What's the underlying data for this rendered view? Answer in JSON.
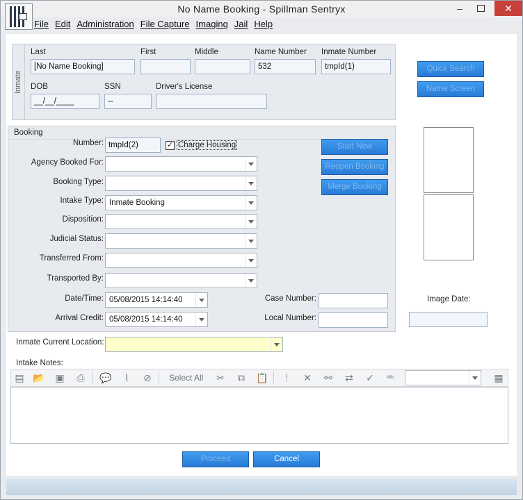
{
  "window": {
    "title": "No Name Booking - Spillman Sentryx",
    "minimize": "–",
    "close": "✕"
  },
  "menu": [
    "File",
    "Edit",
    "Administration",
    "File Capture",
    "Imaging",
    "Jail",
    "Help"
  ],
  "inmate_panel": {
    "side_label": "Inmate",
    "last_label": "Last",
    "last_value": "[No Name Booking]",
    "first_label": "First",
    "first_value": "",
    "middle_label": "Middle",
    "middle_value": "",
    "name_number_label": "Name Number",
    "name_number_value": "532",
    "inmate_number_label": "Inmate Number",
    "inmate_number_value": "tmpId(1)",
    "dob_label": "DOB",
    "dob_value": "__/__/____",
    "ssn_label": "SSN",
    "ssn_value": "--",
    "dl_label": "Driver's License",
    "dl_value": ""
  },
  "side_buttons": {
    "quick_search": "Quick Search",
    "name_screen": "Name Screen"
  },
  "booking": {
    "section_label": "Booking",
    "number_label": "Number:",
    "number_value": "tmpId(2)",
    "charge_housing_label": "Charge Housing",
    "charge_housing_checked": "✓",
    "agency_label": "Agency Booked For:",
    "agency_value": "",
    "booking_type_label": "Booking Type:",
    "booking_type_value": "",
    "intake_type_label": "Intake Type:",
    "intake_type_value": "Inmate Booking",
    "disposition_label": "Disposition:",
    "disposition_value": "",
    "judicial_label": "Judicial Status:",
    "judicial_value": "",
    "transferred_label": "Transferred From:",
    "transferred_value": "",
    "transported_label": "Transported By:",
    "transported_value": "",
    "datetime_label": "Date/Time:",
    "datetime_value": "05/08/2015 14:14:40",
    "arrival_label": "Arrival Credit:",
    "arrival_value": "05/08/2015 14:14:40",
    "case_number_label": "Case Number:",
    "case_number_value": "",
    "local_number_label": "Local Number:",
    "local_number_value": "",
    "start_new": "Start New",
    "reopen_booking": "Reopen Booking",
    "merge_booking": "Merge Booking"
  },
  "image": {
    "date_label": "Image Date:",
    "date_value": ""
  },
  "location": {
    "label": "Inmate Current Location:",
    "value": ""
  },
  "notes": {
    "label": "Intake Notes:",
    "select_all": "Select All",
    "font_value": ""
  },
  "footer": {
    "proceed": "Proceed",
    "cancel": "Cancel"
  }
}
